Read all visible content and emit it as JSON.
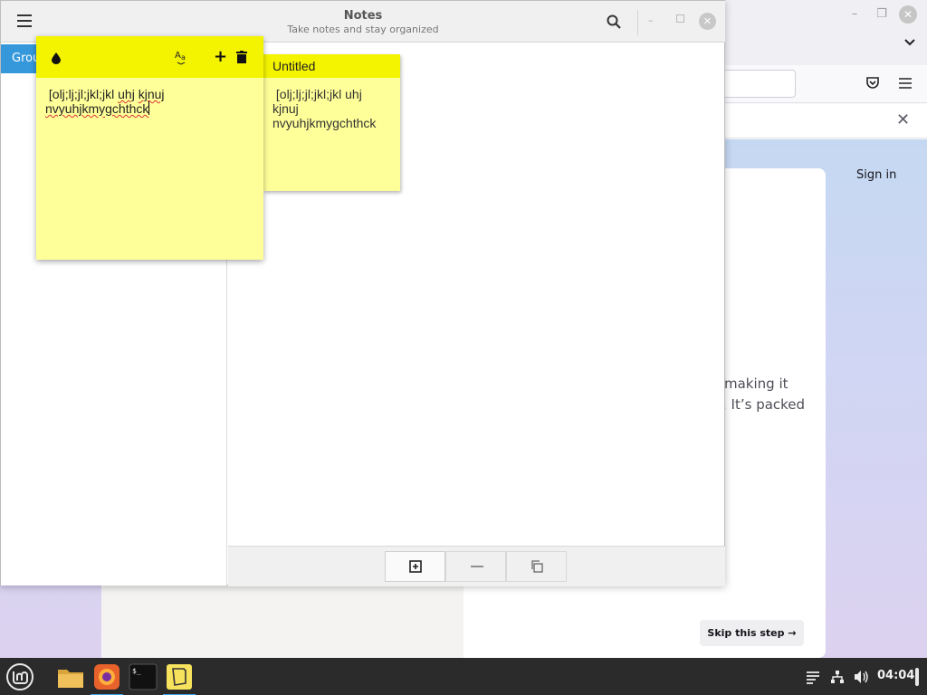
{
  "notes_app": {
    "title": "Notes",
    "subtitle": "Take notes and stay organized",
    "sidebar": {
      "groups": [
        {
          "label": "Groups"
        }
      ]
    }
  },
  "note_card": {
    "title": "Untitled",
    "body_lines": [
      " [olj;lj;jl;jkl;jkl uhj",
      "kjnuj",
      "nvyuhjkmygchthck"
    ]
  },
  "sticky_note": {
    "line1_text": " [olj;lj;jl;jkl;jkl ",
    "line1_word1": "uhj",
    "line1_word2": "kjnuj",
    "line2_text": "nvyuhjkmygchthck",
    "header_color": "#f4f400",
    "body_color": "#ffff99"
  },
  "firefox": {
    "sign_in": "Sign in",
    "line1": "making it",
    "line2": ". It’s packed",
    "skip_button": "Skip this step →"
  },
  "taskbar": {
    "clock": "04:04",
    "apps": [
      "files-icon",
      "firefox-icon",
      "terminal-icon",
      "sticky-notes-icon"
    ],
    "accent": "#3fa3e6"
  },
  "colors": {
    "sidebar_selection": "#3498db",
    "taskbar_bg": "#2b2b2b"
  }
}
